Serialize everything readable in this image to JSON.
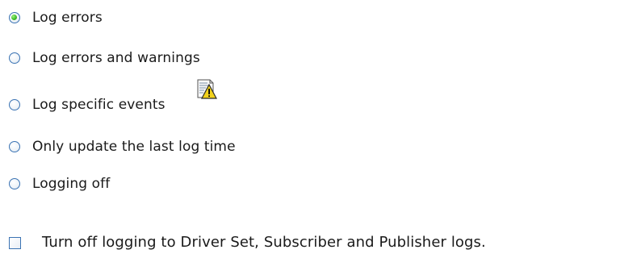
{
  "logging_options": [
    {
      "label": "Log errors",
      "selected": true
    },
    {
      "label": "Log errors and warnings",
      "selected": false
    },
    {
      "label": "Log specific events",
      "selected": false,
      "icon": "event-log-warning-icon"
    },
    {
      "label": "Only update the last log time",
      "selected": false
    },
    {
      "label": "Logging off",
      "selected": false
    }
  ],
  "turn_off_logging": {
    "label": "Turn off logging to Driver Set, Subscriber and Publisher logs.",
    "checked": false
  },
  "colors": {
    "control_border": "#3b73b3",
    "selected_dot": "#3fbf2a",
    "warning_yellow": "#f2d21b"
  }
}
